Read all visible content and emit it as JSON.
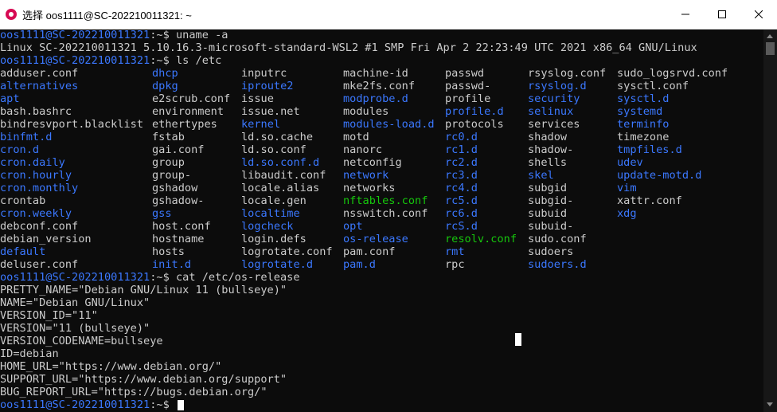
{
  "window": {
    "title": "选择 oos1111@SC-202210011321: ~",
    "minimize_glyph": "—",
    "maximize_glyph": "☐",
    "close_glyph": "✕"
  },
  "terminal": {
    "prompt_user": "oos1111@SC-202210011321",
    "prompt_path": ":~$ ",
    "cmd1": "uname -a",
    "out1": "Linux SC-202210011321 5.10.16.3-microsoft-standard-WSL2 #1 SMP Fri Apr 2 22:23:49 UTC 2021 x86_64 GNU/Linux",
    "cmd2": "ls /etc",
    "ls_rows": [
      [
        "adduser.conf",
        "dhcp",
        "inputrc",
        "machine-id",
        "passwd",
        "rsyslog.conf",
        "sudo_logsrvd.conf"
      ],
      [
        "alternatives",
        "dpkg",
        "iproute2",
        "mke2fs.conf",
        "passwd-",
        "rsyslog.d",
        "sysctl.conf"
      ],
      [
        "apt",
        "e2scrub.conf",
        "issue",
        "modprobe.d",
        "profile",
        "security",
        "sysctl.d"
      ],
      [
        "bash.bashrc",
        "environment",
        "issue.net",
        "modules",
        "profile.d",
        "selinux",
        "systemd"
      ],
      [
        "bindresvport.blacklist",
        "ethertypes",
        "kernel",
        "modules-load.d",
        "protocols",
        "services",
        "terminfo"
      ],
      [
        "binfmt.d",
        "fstab",
        "ld.so.cache",
        "motd",
        "rc0.d",
        "shadow",
        "timezone"
      ],
      [
        "cron.d",
        "gai.conf",
        "ld.so.conf",
        "nanorc",
        "rc1.d",
        "shadow-",
        "tmpfiles.d"
      ],
      [
        "cron.daily",
        "group",
        "ld.so.conf.d",
        "netconfig",
        "rc2.d",
        "shells",
        "udev"
      ],
      [
        "cron.hourly",
        "group-",
        "libaudit.conf",
        "network",
        "rc3.d",
        "skel",
        "update-motd.d"
      ],
      [
        "cron.monthly",
        "gshadow",
        "locale.alias",
        "networks",
        "rc4.d",
        "subgid",
        "vim"
      ],
      [
        "crontab",
        "gshadow-",
        "locale.gen",
        "nftables.conf",
        "rc5.d",
        "subgid-",
        "xattr.conf"
      ],
      [
        "cron.weekly",
        "gss",
        "localtime",
        "nsswitch.conf",
        "rc6.d",
        "subuid",
        "xdg"
      ],
      [
        "debconf.conf",
        "host.conf",
        "logcheck",
        "opt",
        "rcS.d",
        "subuid-",
        ""
      ],
      [
        "debian_version",
        "hostname",
        "login.defs",
        "os-release",
        "resolv.conf",
        "sudo.conf",
        ""
      ],
      [
        "default",
        "hosts",
        "logrotate.conf",
        "pam.conf",
        "rmt",
        "sudoers",
        ""
      ],
      [
        "deluser.conf",
        "init.d",
        "logrotate.d",
        "pam.d",
        "rpc",
        "sudoers.d",
        ""
      ]
    ],
    "ls_colors": [
      [
        "n",
        "d",
        "n",
        "n",
        "n",
        "n",
        "n"
      ],
      [
        "d",
        "d",
        "d",
        "n",
        "n",
        "d",
        "n"
      ],
      [
        "d",
        "n",
        "n",
        "d",
        "n",
        "d",
        "d"
      ],
      [
        "n",
        "n",
        "n",
        "n",
        "d",
        "d",
        "d"
      ],
      [
        "n",
        "n",
        "d",
        "d",
        "n",
        "n",
        "d"
      ],
      [
        "d",
        "n",
        "n",
        "n",
        "d",
        "n",
        "n"
      ],
      [
        "d",
        "n",
        "n",
        "n",
        "d",
        "n",
        "d"
      ],
      [
        "d",
        "n",
        "d",
        "n",
        "d",
        "n",
        "d"
      ],
      [
        "d",
        "n",
        "n",
        "d",
        "d",
        "d",
        "d"
      ],
      [
        "d",
        "n",
        "n",
        "n",
        "d",
        "n",
        "d"
      ],
      [
        "n",
        "n",
        "n",
        "x",
        "d",
        "n",
        "n"
      ],
      [
        "d",
        "d",
        "d",
        "n",
        "d",
        "n",
        "d"
      ],
      [
        "n",
        "n",
        "d",
        "d",
        "d",
        "n",
        "n"
      ],
      [
        "n",
        "n",
        "n",
        "d",
        "x",
        "n",
        "n"
      ],
      [
        "d",
        "n",
        "n",
        "n",
        "d",
        "n",
        "n"
      ],
      [
        "n",
        "d",
        "d",
        "d",
        "n",
        "d",
        "n"
      ]
    ],
    "colors": {
      "directory": "#3b78ff",
      "link": "#16c60c",
      "text": "#cccccc",
      "background": "#0c0c0c"
    },
    "cmd3": "cat /etc/os-release",
    "os_release": [
      "PRETTY_NAME=\"Debian GNU/Linux 11 (bullseye)\"",
      "NAME=\"Debian GNU/Linux\"",
      "VERSION_ID=\"11\"",
      "VERSION=\"11 (bullseye)\"",
      "VERSION_CODENAME=bullseye",
      "ID=debian",
      "HOME_URL=\"https://www.debian.org/\"",
      "SUPPORT_URL=\"https://www.debian.org/support\"",
      "BUG_REPORT_URL=\"https://bugs.debian.org/\""
    ]
  }
}
